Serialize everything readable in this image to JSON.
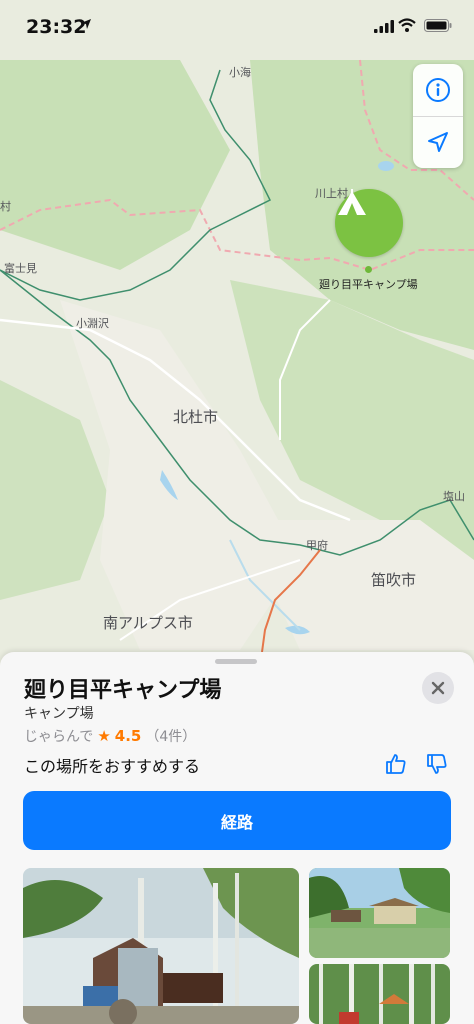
{
  "status": {
    "time": "23:32"
  },
  "map_controls": {
    "info_icon": "info-icon",
    "location_icon": "location-arrow-icon"
  },
  "map": {
    "labels": {
      "koumi": "小海",
      "kawakami": "川上村",
      "mura": "村",
      "fujimi": "富士見",
      "kobuchizawa": "小淵沢",
      "hokuto": "北杜市",
      "enzan": "塩山",
      "kofu": "甲府",
      "fuefuki": "笛吹市",
      "minami_alps": "南アルプス市"
    },
    "pin": {
      "label": "廻り目平キャンプ場",
      "icon": "tent-icon",
      "color": "#7cc242"
    }
  },
  "place": {
    "name": "廻り目平キャンプ場",
    "category": "キャンプ場",
    "rating_source": "じゃらんで",
    "rating_star": "★",
    "rating": "4.5",
    "rating_count": "（4件）",
    "recommend_text": "この場所をおすすめする",
    "route_label": "経路"
  },
  "colors": {
    "accent": "#0a7aff",
    "rating": "#ff7a00",
    "forest": "#c5dfb3"
  }
}
